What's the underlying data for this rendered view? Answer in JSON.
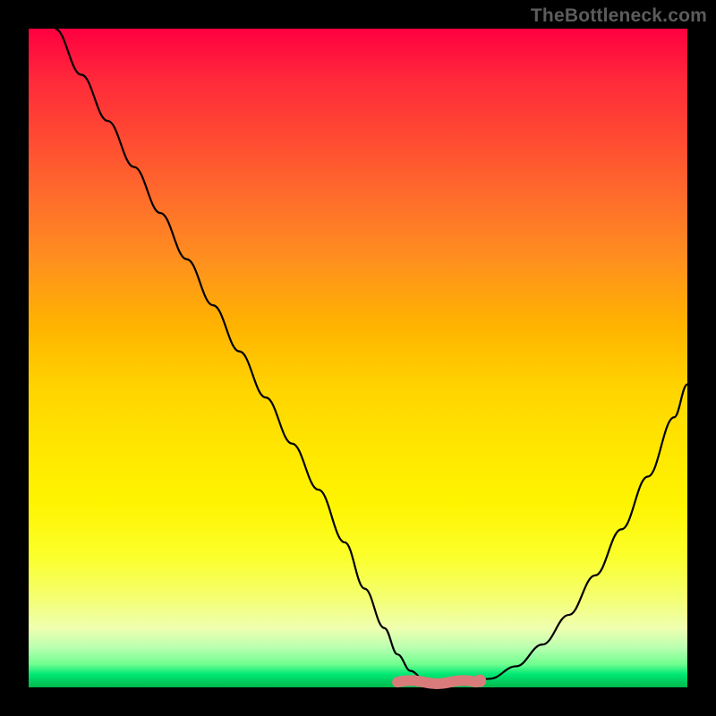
{
  "watermark": "TheBottleneck.com",
  "colors": {
    "background": "#000000",
    "curve": "#000000",
    "marker_fill": "#d97b7b",
    "marker_stroke": "#d97b7b",
    "gradient_top": "#ff0040",
    "gradient_bottom": "#00b84c"
  },
  "chart_data": {
    "type": "line",
    "title": "",
    "xlabel": "",
    "ylabel": "",
    "xlim": [
      0,
      100
    ],
    "ylim": [
      0,
      100
    ],
    "grid": false,
    "legend": false,
    "series": [
      {
        "name": "bottleneck-curve",
        "x": [
          4,
          8,
          12,
          16,
          20,
          24,
          28,
          32,
          36,
          40,
          44,
          48,
          51,
          54,
          56,
          58,
          60,
          62,
          64,
          66,
          70,
          74,
          78,
          82,
          86,
          90,
          94,
          98,
          100
        ],
        "values": [
          100,
          93,
          86,
          79,
          72,
          65,
          58,
          51,
          44,
          37,
          30,
          22,
          15,
          9,
          5,
          2.5,
          1.2,
          0.6,
          0.3,
          0.5,
          1.3,
          3.2,
          6.5,
          11,
          17,
          24,
          32,
          41,
          46
        ]
      }
    ],
    "annotations": [
      {
        "name": "optimal-range-highlight",
        "x_start": 56,
        "x_end": 68,
        "y": 0.8
      },
      {
        "name": "optimal-end-dot",
        "x": 68.5,
        "y": 1.0
      }
    ]
  }
}
